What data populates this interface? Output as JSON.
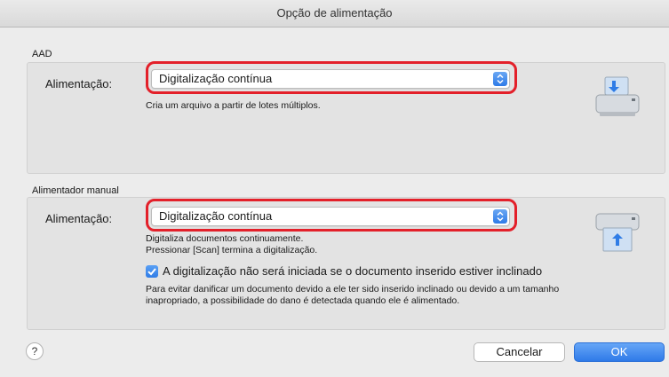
{
  "window": {
    "title": "Opção de alimentação"
  },
  "aad": {
    "section_label": "AAD",
    "field_label": "Alimentação:",
    "selected": "Digitalização contínua",
    "description": "Cria um arquivo a partir de lotes múltiplos.",
    "icon": "scanner-adf-icon"
  },
  "manual": {
    "section_label": "Alimentador manual",
    "field_label": "Alimentação:",
    "selected": "Digitalização contínua",
    "description_1": "Digitaliza documentos continuamente.",
    "description_2": "Pressionar [Scan] termina a digitalização.",
    "icon": "scanner-manual-feed-icon",
    "checkbox_checked": true,
    "checkbox_label": "A digitalização não será iniciada se o documento inserido estiver inclinado",
    "checkbox_note_1": "Para evitar danificar um documento devido a ele ter sido inserido inclinado ou devido a um tamanho",
    "checkbox_note_2": "inapropriado, a possibilidade do dano é detectada quando ele é alimentado."
  },
  "footer": {
    "help_label": "?",
    "cancel_label": "Cancelar",
    "ok_label": "OK"
  },
  "colors": {
    "highlight": "#e3202a",
    "accent": "#2f7ce6"
  }
}
